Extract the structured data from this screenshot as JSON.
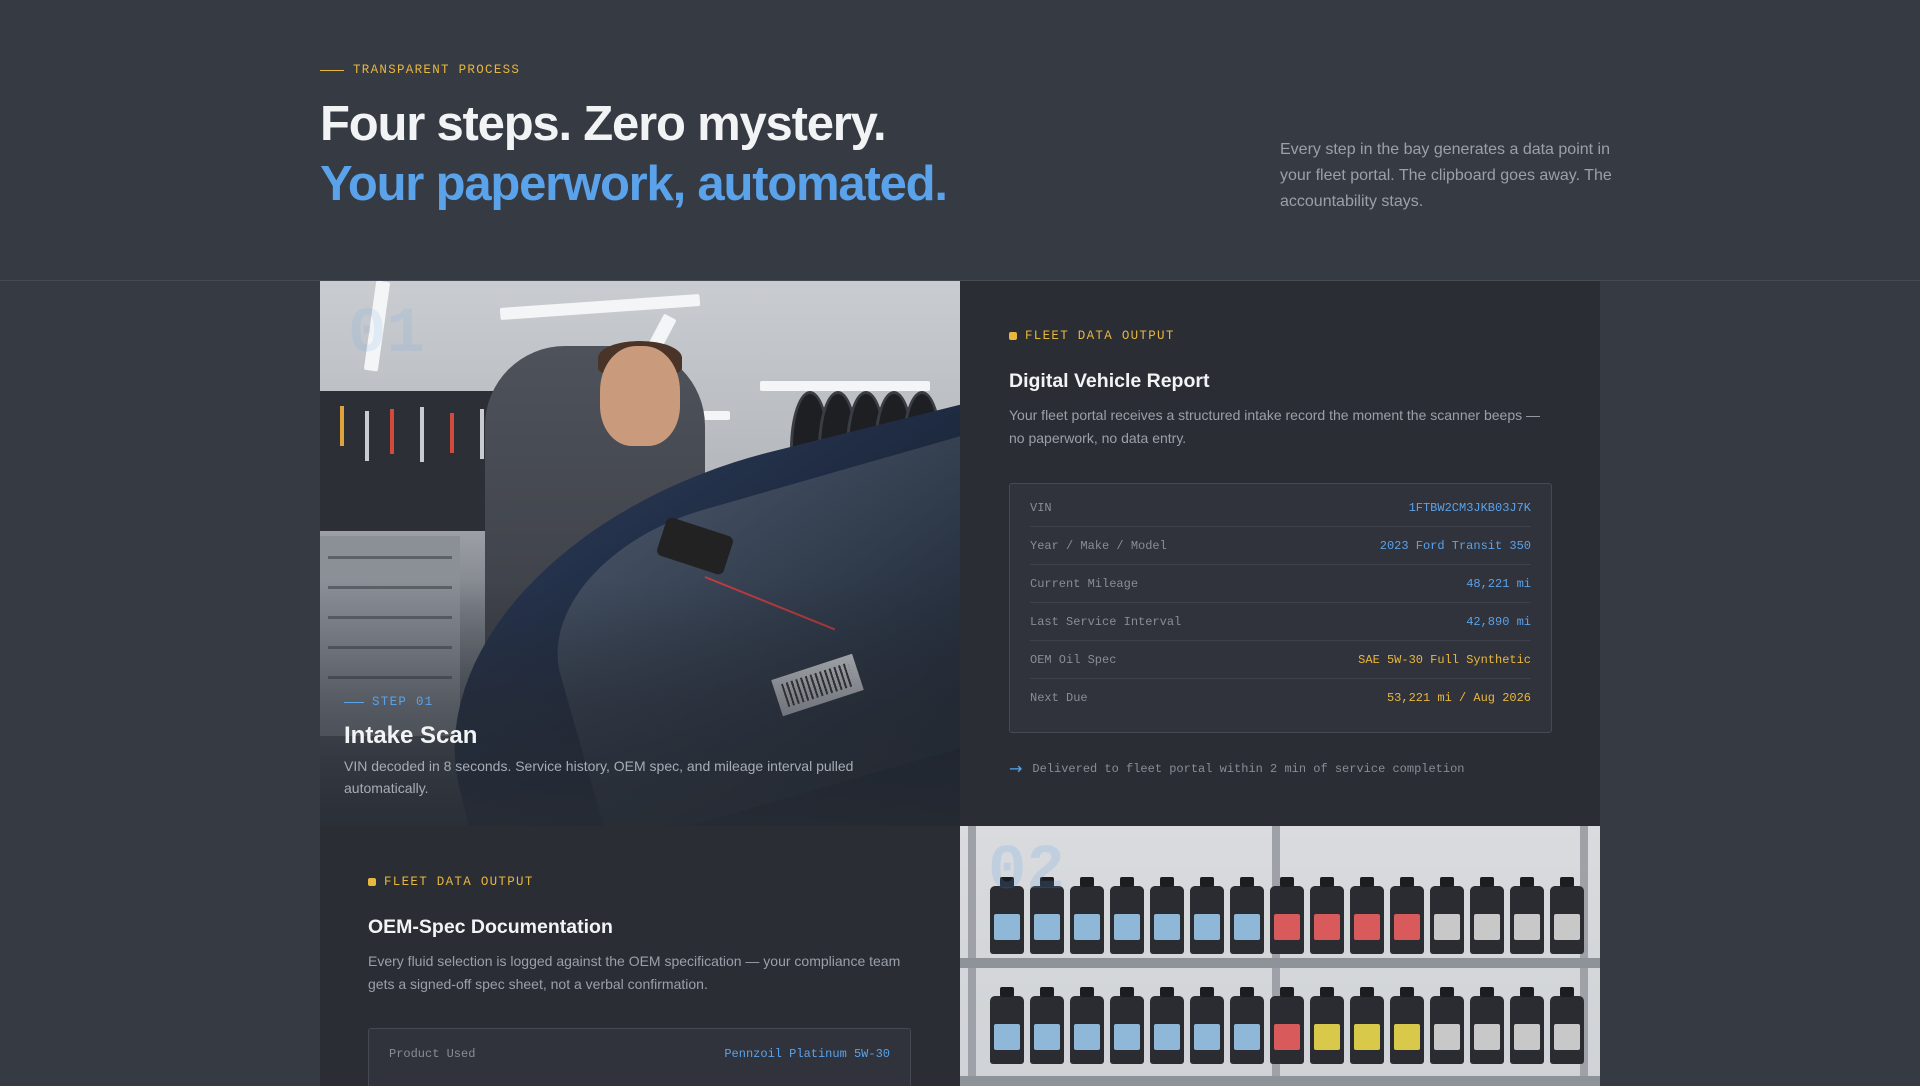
{
  "header": {
    "eyebrow": "TRANSPARENT PROCESS",
    "headline_line1": "Four steps. Zero mystery.",
    "headline_line2": "Your paperwork, automated.",
    "intro": "Every step in the bay generates a data point in your fleet portal. The clipboard goes away. The accountability stays."
  },
  "step1": {
    "number": "01",
    "label": "STEP 01",
    "title": "Intake Scan",
    "description": "VIN decoded in 8 seconds. Service history, OEM spec, and mileage interval pulled automatically."
  },
  "report": {
    "tag": "FLEET DATA OUTPUT",
    "title": "Digital Vehicle Report",
    "description": "Your fleet portal receives a structured intake record the moment the scanner beeps — no paperwork, no data entry.",
    "rows": [
      {
        "key": "VIN",
        "value": "1FTBW2CM3JKB03J7K",
        "accent": "blue"
      },
      {
        "key": "Year / Make / Model",
        "value": "2023 Ford Transit 350",
        "accent": "blue"
      },
      {
        "key": "Current Mileage",
        "value": "48,221 mi",
        "accent": "blue"
      },
      {
        "key": "Last Service Interval",
        "value": "42,890 mi",
        "accent": "blue"
      },
      {
        "key": "OEM Oil Spec",
        "value": "SAE 5W-30 Full Synthetic",
        "accent": "gold"
      },
      {
        "key": "Next Due",
        "value": "53,221 mi / Aug 2026",
        "accent": "gold"
      }
    ],
    "delivered": "Delivered to fleet portal within 2 min of service completion",
    "delivered_icon": "arrow-right-icon"
  },
  "oem": {
    "tag": "FLEET DATA OUTPUT",
    "title": "OEM-Spec Documentation",
    "description": "Every fluid selection is logged against the OEM specification — your compliance team gets a signed-off spec sheet, not a verbal confirmation.",
    "rows": [
      {
        "key": "Product Used",
        "value": "Pennzoil Platinum 5W-30",
        "accent": "blue"
      }
    ]
  },
  "step2": {
    "number": "02"
  },
  "colors": {
    "accent_blue": "#5aa2ea",
    "accent_gold": "#e7b73f",
    "background": "#363a43",
    "panel": "#2a2d34"
  }
}
